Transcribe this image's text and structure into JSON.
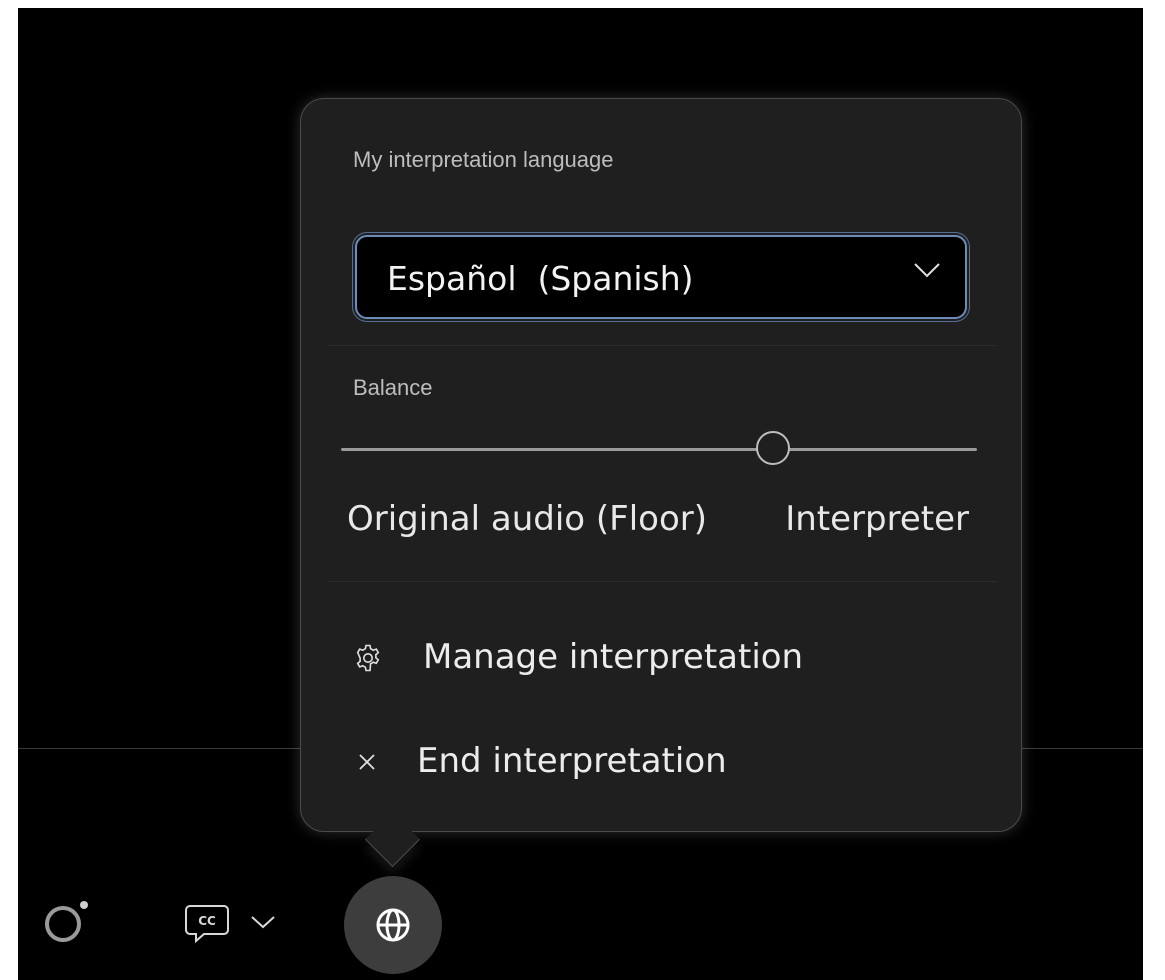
{
  "popover": {
    "language_label": "My interpretation language",
    "language_value": "Español  (Spanish)",
    "balance_label": "Balance",
    "balance_level": 0.68,
    "balance_left_label": "Original audio (Floor)",
    "balance_right_label": "Interpreter",
    "menu": [
      {
        "label": "Manage interpretation",
        "icon": "gear-icon"
      },
      {
        "label": "End interpretation",
        "icon": "close-icon"
      }
    ]
  },
  "toolbar": {
    "items": [
      {
        "icon": "ring-status-icon"
      },
      {
        "icon": "closed-captions-icon",
        "label": "CC"
      },
      {
        "icon": "globe-icon",
        "active": true
      }
    ]
  },
  "colors": {
    "background": "#000000",
    "popover": "#1f1f1f",
    "focus_border": "#6e8bb8",
    "active_button": "#3d3d3d"
  }
}
